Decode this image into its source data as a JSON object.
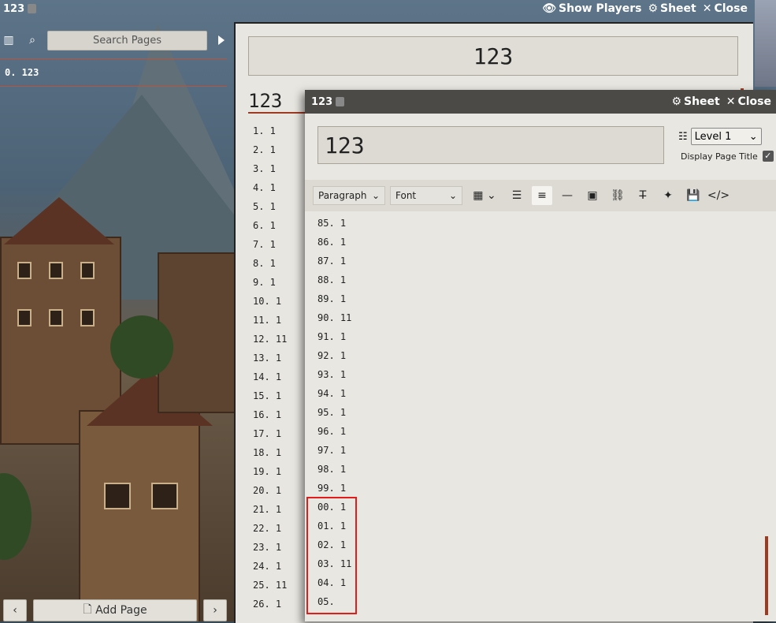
{
  "top_left": {
    "title": "123"
  },
  "top_right": {
    "show_players": "Show Players",
    "sheet": "Sheet",
    "close": "Close"
  },
  "pages_panel": {
    "search_placeholder": "Search Pages",
    "pages": [
      {
        "label": "0.  123"
      }
    ],
    "add_page": "Add Page"
  },
  "journal": {
    "title": "123",
    "heading": "123",
    "items": [
      "1. 1",
      "2. 1",
      "3. 1",
      "4. 1",
      "5. 1",
      "6. 1",
      "7. 1",
      "8. 1",
      "9. 1",
      "10. 1",
      "11. 1",
      "12. 11",
      "13. 1",
      "14. 1",
      "15. 1",
      "16. 1",
      "17. 1",
      "18. 1",
      "19. 1",
      "20. 1",
      "21. 1",
      "22. 1",
      "23. 1",
      "24. 1",
      "25. 11",
      "26. 1"
    ]
  },
  "editor": {
    "window_title": "123",
    "sheet": "Sheet",
    "close": "Close",
    "page_title": "123",
    "level": "Level 1",
    "display_page_title": "Display Page Title",
    "toolbar": {
      "paragraph": "Paragraph",
      "font": "Font"
    },
    "items": [
      "85. 1",
      "86. 1",
      "87. 1",
      "88. 1",
      "89. 1",
      "90. 11",
      "91. 1",
      "92. 1",
      "93. 1",
      "94. 1",
      "95. 1",
      "96. 1",
      "97. 1",
      "98. 1",
      "99. 1",
      "00. 1",
      "01. 1",
      "02. 1",
      "03. 11",
      "04. 1",
      "05."
    ]
  }
}
